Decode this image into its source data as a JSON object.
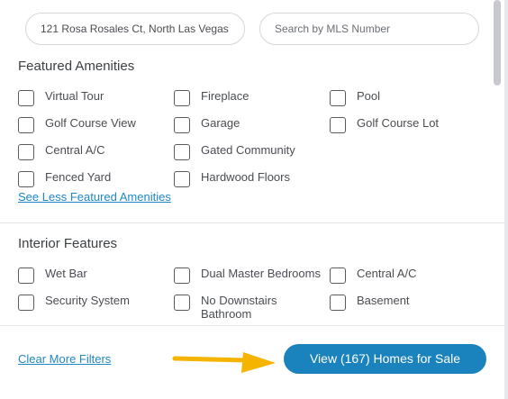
{
  "search": {
    "address_value": "121 Rosa Rosales Ct, North Las Vegas",
    "mls_placeholder": "Search by MLS Number"
  },
  "featured_amenities": {
    "title": "Featured Amenities",
    "items": [
      {
        "label": "Virtual Tour"
      },
      {
        "label": "Fireplace"
      },
      {
        "label": "Pool"
      },
      {
        "label": "Golf Course View"
      },
      {
        "label": "Garage"
      },
      {
        "label": "Golf Course Lot"
      },
      {
        "label": "Central A/C"
      },
      {
        "label": "Gated Community"
      },
      {
        "label": "Fenced Yard"
      },
      {
        "label": "Hardwood Floors"
      }
    ],
    "see_less_label": "See Less Featured Amenities"
  },
  "interior_features": {
    "title": "Interior Features",
    "items": [
      {
        "label": "Wet Bar"
      },
      {
        "label": "Dual Master Bedrooms"
      },
      {
        "label": "Central A/C"
      },
      {
        "label": "Security System"
      },
      {
        "label": "No Downstairs Bathroom"
      },
      {
        "label": "Basement"
      }
    ]
  },
  "footer": {
    "clear_label": "Clear More Filters",
    "view_button_label": "View (167) Homes for Sale"
  },
  "colors": {
    "accent": "#1a83bd",
    "link": "#1f87c2",
    "arrow": "#f4b400"
  }
}
